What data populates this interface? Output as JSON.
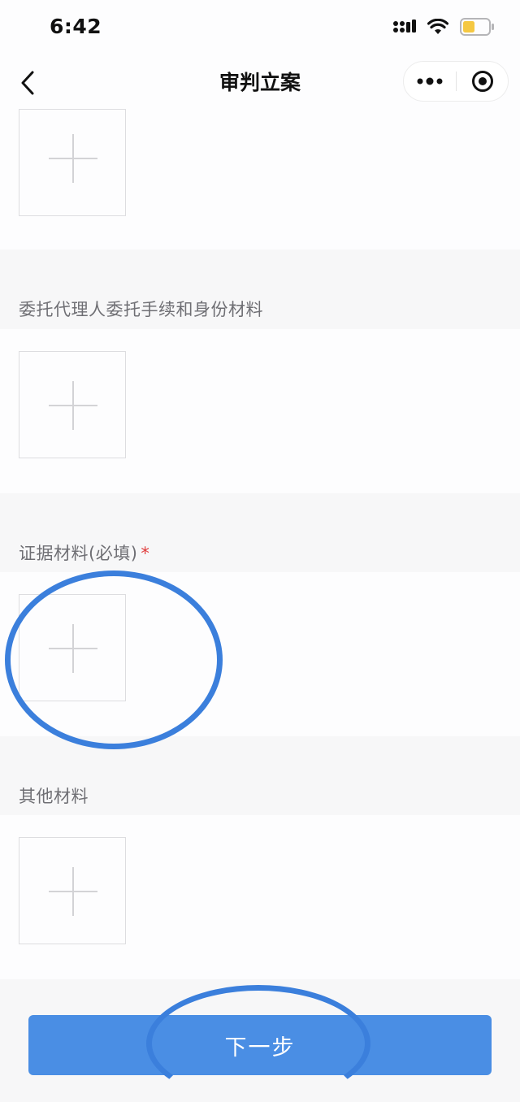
{
  "status_bar": {
    "time": "6:42",
    "icons": [
      "signal-icon",
      "wifi-icon",
      "battery-icon"
    ],
    "battery_color": "#f5c842"
  },
  "nav": {
    "title": "审判立案",
    "back_icon": "chevron-left-icon",
    "more_icon": "more-dots-icon",
    "close_icon": "mini-program-close-icon"
  },
  "sections": [
    {
      "label": "",
      "upload_icon": "plus-icon"
    },
    {
      "label": "委托代理人委托手续和身份材料",
      "upload_icon": "plus-icon"
    },
    {
      "label": "证据材料(必填)",
      "required_mark": "*",
      "upload_icon": "plus-icon"
    },
    {
      "label": "其他材料",
      "upload_icon": "plus-icon"
    }
  ],
  "next_button": {
    "label": "下一步"
  },
  "colors": {
    "accent": "#4a8ee4",
    "annotation": "#3b7fdc",
    "required": "#e03a3a"
  }
}
